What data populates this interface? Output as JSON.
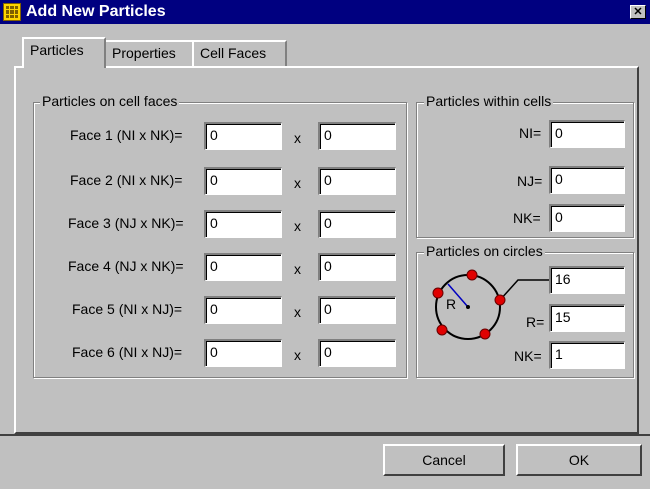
{
  "window": {
    "title": "Add New Particles",
    "close_glyph": "✕"
  },
  "tabs": [
    {
      "label": "Particles"
    },
    {
      "label": "Properties"
    },
    {
      "label": "Cell Faces"
    }
  ],
  "cell_faces_group": {
    "legend": "Particles on cell faces",
    "times_glyph": "x",
    "rows": [
      {
        "label": "Face 1 (NI x NK)=",
        "a": "0",
        "b": "0"
      },
      {
        "label": "Face 2 (NI x NK)=",
        "a": "0",
        "b": "0"
      },
      {
        "label": "Face 3 (NJ x NK)=",
        "a": "0",
        "b": "0"
      },
      {
        "label": "Face 4 (NJ x NK)=",
        "a": "0",
        "b": "0"
      },
      {
        "label": "Face 5 (NI x NJ)=",
        "a": "0",
        "b": "0"
      },
      {
        "label": "Face 6 (NI x NJ)=",
        "a": "0",
        "b": "0"
      }
    ]
  },
  "within_cells_group": {
    "legend": "Particles within cells",
    "ni_label": "NI=",
    "ni_value": "0",
    "nj_label": "NJ=",
    "nj_value": "0",
    "nk_label": "NK=",
    "nk_value": "0"
  },
  "circles_group": {
    "legend": "Particles on circles",
    "diagram_r": "R",
    "count_value": "16",
    "r_label": "R=",
    "r_value": "15",
    "nk_label": "NK=",
    "nk_value": "1"
  },
  "buttons": {
    "cancel": "Cancel",
    "ok": "OK"
  },
  "colors": {
    "titlebar": "#000080",
    "face": "#c0c0c0",
    "dots": "#e00000",
    "radius_line": "#0000c0"
  }
}
